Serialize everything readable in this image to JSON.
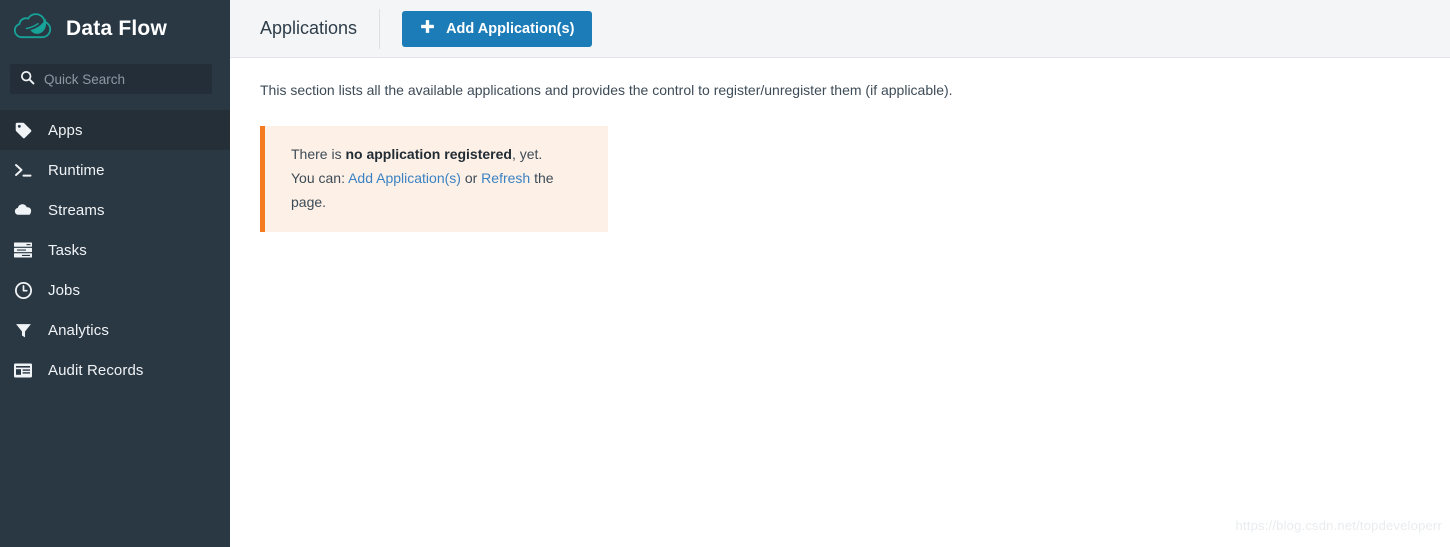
{
  "brand": {
    "title": "Data Flow",
    "logo_icon": "spring-cloud-leaf-logo"
  },
  "search": {
    "placeholder": "Quick Search",
    "value": "",
    "icon": "search-icon"
  },
  "sidebar": {
    "items": [
      {
        "label": "Apps",
        "icon": "tag-icon",
        "active": true
      },
      {
        "label": "Runtime",
        "icon": "terminal-icon",
        "active": false
      },
      {
        "label": "Streams",
        "icon": "cloud-icon",
        "active": false
      },
      {
        "label": "Tasks",
        "icon": "server-icon",
        "active": false
      },
      {
        "label": "Jobs",
        "icon": "clock-icon",
        "active": false
      },
      {
        "label": "Analytics",
        "icon": "funnel-icon",
        "active": false
      },
      {
        "label": "Audit Records",
        "icon": "list-icon",
        "active": false
      }
    ]
  },
  "topbar": {
    "page_title": "Applications",
    "add_button_label": "Add Application(s)",
    "add_button_icon": "plus-icon"
  },
  "content": {
    "description": "This section lists all the available applications and provides the control to register/unregister them (if applicable).",
    "alert": {
      "line1_prefix": "There is ",
      "line1_strong": "no application registered",
      "line1_suffix": ", yet.",
      "line2_prefix": "You can: ",
      "link_add": "Add Application(s)",
      "line2_middle": " or ",
      "link_refresh": "Refresh",
      "line2_suffix": " the page."
    }
  },
  "watermark": "https://blog.csdn.net/topdeveloperr",
  "colors": {
    "sidebar_bg": "#2a3844",
    "sidebar_active_bg": "#242f38",
    "search_bg": "#232e38",
    "brand_teal": "#17a398",
    "topbar_bg": "#f4f5f7",
    "primary_button": "#1b7cb8",
    "alert_bg": "#fdf0e6",
    "alert_border": "#f47b20",
    "link_blue": "#3b82c4",
    "text_dark": "#2e3d49"
  }
}
